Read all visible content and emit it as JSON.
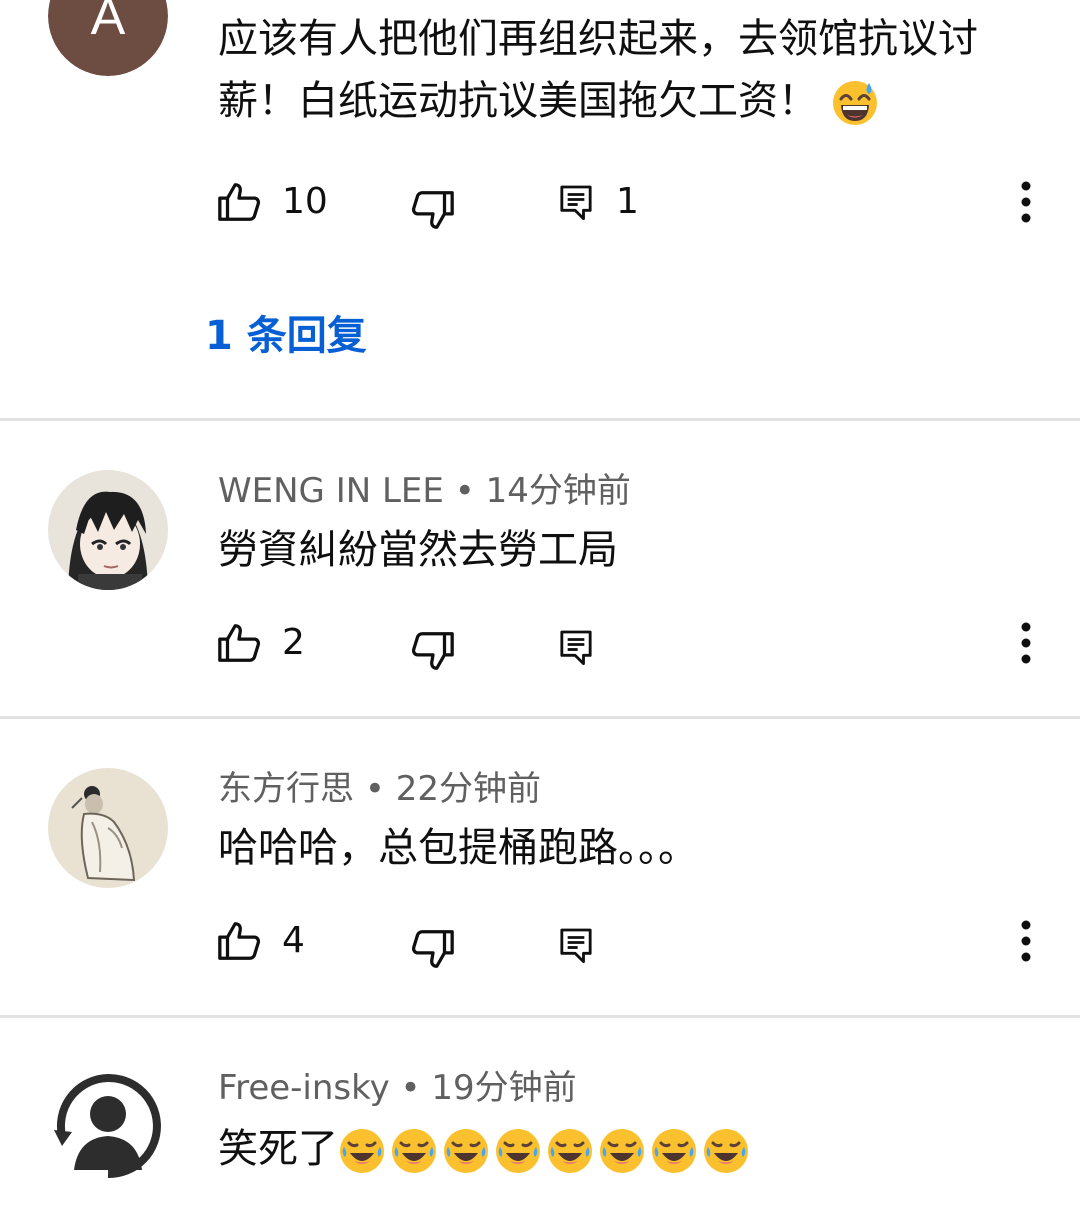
{
  "comments": [
    {
      "avatar_letter": "A",
      "avatar_color": "#6d4c41",
      "text_line1": "应该有人把他们再组织起来，去领馆抗议讨",
      "text_line2": "薪！白纸运动抗议美国拖欠工资！",
      "emoji": "grinning-sweat-emoji",
      "likes": "10",
      "reply_count": "1",
      "replies_link": "1 条回复"
    },
    {
      "author": "WENG IN LEE",
      "time": "14分钟前",
      "text": "勞資糾紛當然去勞工局",
      "avatar": "anime-character-avatar",
      "likes": "2"
    },
    {
      "author": "东方行思",
      "time": "22分钟前",
      "text": "哈哈哈，总包提桶跑路。。。",
      "avatar": "ink-painting-avatar",
      "likes": "4"
    },
    {
      "author": "Free-insky",
      "time": "19分钟前",
      "text": "笑死了",
      "avatar": "default-person-avatar",
      "emoji": "rolling-laughing-emoji",
      "emoji_count": 8
    }
  ],
  "separator": "•",
  "colors": {
    "link_blue": "#065fd4",
    "meta_gray": "#606060",
    "divider": "#e2e2e2",
    "text": "#0f0f0f"
  },
  "icons": {
    "like": "thumbs-up-icon",
    "dislike": "thumbs-down-icon",
    "reply": "comment-icon",
    "more": "more-vert-icon"
  }
}
